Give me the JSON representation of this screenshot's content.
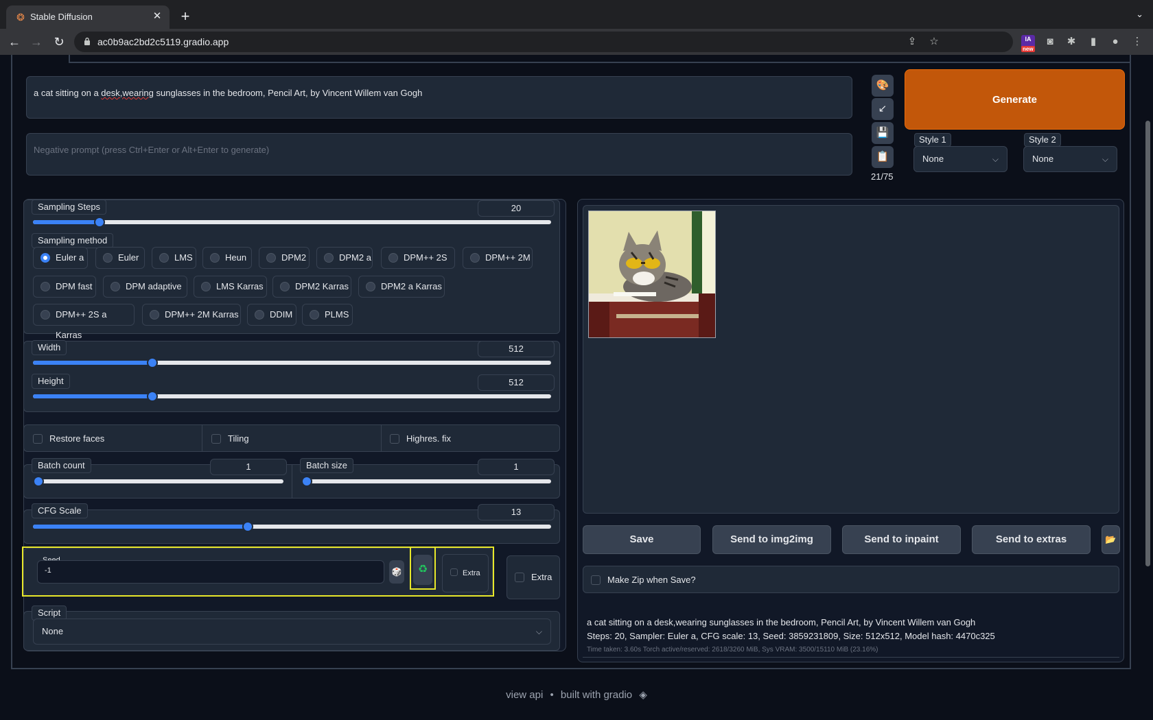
{
  "browser": {
    "tab_title": "Stable Diffusion",
    "new_tab": "+",
    "url": "ac0b9ac2bd2c5119.gradio.app",
    "extension_ia": "IA",
    "extension_ia_badge": "new"
  },
  "prompt": {
    "pre": "a cat sitting on a ",
    "misspelled": "desk,wearing",
    "post": " sunglasses in the bedroom, Pencil Art, by Vincent Willem van Gogh",
    "negative_placeholder": "Negative prompt (press Ctrl+Enter or Alt+Enter to generate)",
    "token_count": "21/75"
  },
  "generate_label": "Generate",
  "styles": [
    {
      "label": "Style 1",
      "value": "None"
    },
    {
      "label": "Style 2",
      "value": "None"
    }
  ],
  "sampling_steps": {
    "label": "Sampling Steps",
    "value": "20",
    "fraction": 0.128
  },
  "sampling_method": {
    "label": "Sampling method",
    "selected": "Euler a",
    "options": [
      "Euler a",
      "Euler",
      "LMS",
      "Heun",
      "DPM2",
      "DPM2 a",
      "DPM++ 2S a",
      "DPM++ 2M",
      "DPM fast",
      "DPM adaptive",
      "LMS Karras",
      "DPM2 Karras",
      "DPM2 a Karras",
      "DPM++ 2S a Karras",
      "DPM++ 2M Karras",
      "DDIM",
      "PLMS"
    ]
  },
  "width": {
    "label": "Width",
    "value": "512",
    "fraction": 0.231
  },
  "height": {
    "label": "Height",
    "value": "512",
    "fraction": 0.231
  },
  "options": {
    "restore_faces": "Restore faces",
    "tiling": "Tiling",
    "highres_fix": "Highres. fix"
  },
  "batch_count": {
    "label": "Batch count",
    "value": "1",
    "fraction": 0.0
  },
  "batch_size": {
    "label": "Batch size",
    "value": "1",
    "fraction": 0.0
  },
  "cfg_scale": {
    "label": "CFG Scale",
    "value": "13",
    "fraction": 0.414
  },
  "seed": {
    "label": "Seed",
    "value": "-1",
    "extra_label": "Extra",
    "extra_outer_label": "Extra"
  },
  "script": {
    "label": "Script",
    "value": "None"
  },
  "output_buttons": {
    "save": "Save",
    "img2img": "Send to img2img",
    "inpaint": "Send to inpaint",
    "extras": "Send to extras"
  },
  "make_zip": "Make Zip when Save?",
  "generation_info": {
    "line1": "a cat sitting on a desk,wearing sunglasses in the bedroom, Pencil Art, by Vincent Willem van Gogh",
    "line2": "Steps: 20, Sampler: Euler a, CFG scale: 13, Seed: 3859231809, Size: 512x512, Model hash: 4470c325",
    "line3": "Time taken: 3.60s  Torch active/reserved: 2618/3260 MiB, Sys VRAM: 3500/15110 MiB (23.16%)"
  },
  "footer": {
    "view_api": "view api",
    "separator": "•",
    "built_with": "built with gradio"
  },
  "colors": {
    "accent": "#3b82f6",
    "generate": "#c2570a",
    "highlight": "#e8e82a"
  }
}
